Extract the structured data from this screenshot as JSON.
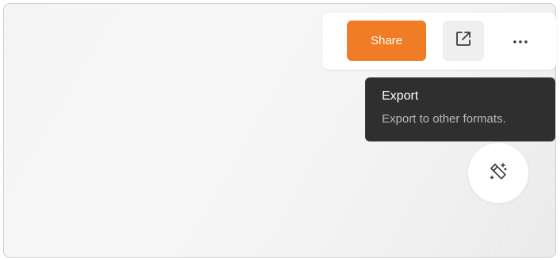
{
  "toolbar": {
    "share_label": "Share",
    "export_icon": "external-link-icon",
    "more_icon": "more-horizontal-icon"
  },
  "tooltip": {
    "title": "Export",
    "subtitle": "Export to other formats."
  },
  "fab": {
    "icon": "magic-wand-icon"
  },
  "colors": {
    "accent": "#f07d25",
    "tooltip_bg": "#2f2f2f",
    "tooltip_sub": "#b9b9b9"
  }
}
